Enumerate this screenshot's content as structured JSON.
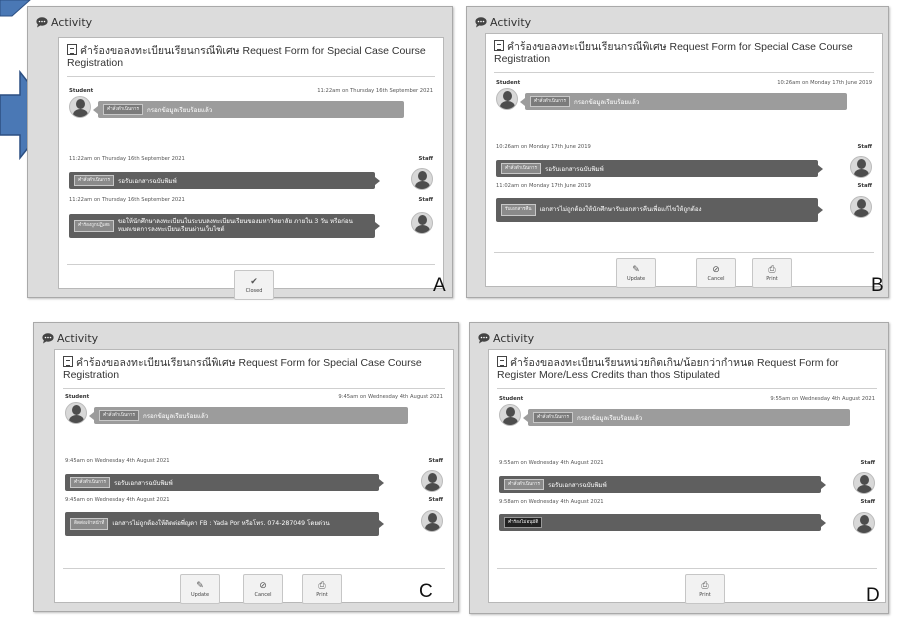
{
  "activity_label": "Activity",
  "panels": {
    "A": {
      "letter": "A",
      "title": "คำร้องขอลงทะเบียนเรียนกรณีพิเศษ Request Form for Special Case Course Registration",
      "student_label": "Student",
      "student_time": "11:22am on Thursday 16th September 2021",
      "student_tag": "คำสั่งดำเนินการ",
      "student_msg": "กรอกข้อมูลเรียบร้อยแล้ว",
      "staff1_time": "11:22am on Thursday 16th September 2021",
      "staff_label": "Staff",
      "staff1_tag": "คำสั่งดำเนินการ",
      "staff1_msg": "รอรับเอกสารฉบับพิมพ์",
      "staff2_time": "11:22am on Thursday 16th September 2021",
      "staff2_tag": "คำร้องถูกปฏิเสธ",
      "staff2_msg": "ขอให้นักศึกษาลงทะเบียนในระบบลงทะเบียนเรียนของมหาวิทยาลัย ภายใน 3 วัน หรือก่อนหมดเขตการลงทะเบียนเรียนผ่านเว็บไซต์",
      "buttons": [
        {
          "label": "Closed",
          "icon": "check-circle-icon",
          "glyph": "✔"
        }
      ]
    },
    "B": {
      "letter": "B",
      "title": "คำร้องขอลงทะเบียนเรียนกรณีพิเศษ Request Form for Special Case Course Registration",
      "student_label": "Student",
      "student_time": "10:26am on Monday 17th June 2019",
      "student_tag": "คำสั่งดำเนินการ",
      "student_msg": "กรอกข้อมูลเรียบร้อยแล้ว",
      "staff1_time": "10:26am on Monday 17th June 2019",
      "staff_label": "Staff",
      "staff1_tag": "คำสั่งดำเนินการ",
      "staff1_msg": "รอรับเอกสารฉบับพิมพ์",
      "staff2_time": "11:02am on Monday 17th June 2019",
      "staff2_tag": "รับเอกสารคืน",
      "staff2_msg": "เอกสารไม่ถูกต้องให้นักศึกษารับเอกสารคืนเพื่อแก้ไขให้ถูกต้อง",
      "buttons": [
        {
          "label": "Update",
          "icon": "pencil-icon",
          "glyph": "✎"
        },
        {
          "label": "Cancel",
          "icon": "cancel-icon",
          "glyph": "⊘"
        },
        {
          "label": "Print",
          "icon": "printer-icon",
          "glyph": "⎙"
        }
      ]
    },
    "C": {
      "letter": "C",
      "title": "คำร้องขอลงทะเบียนเรียนกรณีพิเศษ Request Form for Special Case Course Registration",
      "student_label": "Student",
      "student_time": "9:45am on Wednesday 4th August 2021",
      "student_tag": "คำสั่งดำเนินการ",
      "student_msg": "กรอกข้อมูลเรียบร้อยแล้ว",
      "staff1_time": "9:45am on Wednesday 4th August 2021",
      "staff_label": "Staff",
      "staff1_tag": "คำสั่งดำเนินการ",
      "staff1_msg": "รอรับเอกสารฉบับพิมพ์",
      "staff2_time": "9:45am on Wednesday 4th August 2021",
      "staff2_tag": "ติดต่อเจ้าหน้าที่",
      "staff2_msg": "เอกสารไม่ถูกต้องให้ติดต่อพี่ญดา FB : Yada Por หรือโทร. 074-287049 โดยด่วน",
      "buttons": [
        {
          "label": "Update",
          "icon": "pencil-icon",
          "glyph": "✎"
        },
        {
          "label": "Cancel",
          "icon": "cancel-icon",
          "glyph": "⊘"
        },
        {
          "label": "Print",
          "icon": "printer-icon",
          "glyph": "⎙"
        }
      ]
    },
    "D": {
      "letter": "D",
      "title": "คำร้องขอลงทะเบียนเรียนหน่วยกิตเกิน/น้อยกว่ากำหนด Request Form for Register More/Less Credits than thos Stipulated",
      "student_label": "Student",
      "student_time": "9:55am on Wednesday 4th August 2021",
      "student_tag": "คำสั่งดำเนินการ",
      "student_msg": "กรอกข้อมูลเรียบร้อยแล้ว",
      "staff1_time": "9:55am on Wednesday 4th August 2021",
      "staff_label": "Staff",
      "staff1_tag": "คำสั่งดำเนินการ",
      "staff1_msg": "รอรับเอกสารฉบับพิมพ์",
      "staff2_time": "9:58am on Wednesday 4th August 2021",
      "staff2_tag": "คำร้องไม่อนุมัติ",
      "staff2_msg": "",
      "buttons": [
        {
          "label": "Print",
          "icon": "printer-icon",
          "glyph": "⎙"
        }
      ]
    }
  }
}
